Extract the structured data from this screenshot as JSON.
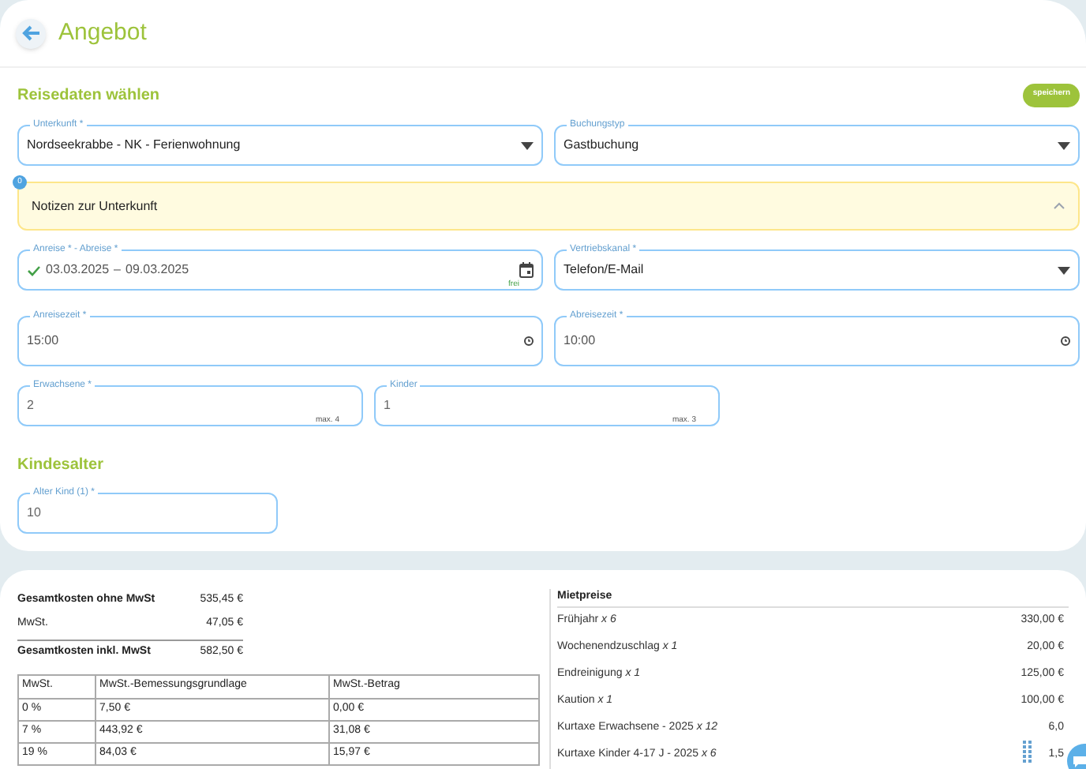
{
  "header": {
    "title": "Angebot"
  },
  "section_title": "Reisedaten wählen",
  "save_button": "speichern",
  "row1": [
    {
      "kind": "select",
      "label": "Unterkunft *",
      "value": "Nordseekrabbe - NK - Ferienwohnung"
    },
    {
      "kind": "select",
      "label": "Buchungstyp",
      "value": "Gastbuchung"
    }
  ],
  "notes": {
    "badge": "0",
    "title": "Notizen zur Unterkunft",
    "expanded": true
  },
  "row2": [
    {
      "kind": "daterange",
      "label": "Anreise * - Abreise *",
      "start": "03.03.2025",
      "sep": "–",
      "end": "09.03.2025",
      "hint": "frei",
      "valid": true
    },
    {
      "kind": "select",
      "label": "Vertriebskanal *",
      "value": "Telefon/E-Mail"
    }
  ],
  "row3": [
    {
      "kind": "time",
      "label": "Anreisezeit *",
      "value": "15:00"
    },
    {
      "kind": "time",
      "label": "Abreisezeit *",
      "value": "10:00"
    }
  ],
  "row4": [
    {
      "kind": "number",
      "label": "Erwachsene *",
      "value": "2",
      "hint": "max. 4"
    },
    {
      "kind": "number",
      "label": "Kinder",
      "value": "1",
      "hint": "max. 3"
    }
  ],
  "children_title": "Kindesalter",
  "child_ages": [
    {
      "kind": "number",
      "label": "Alter Kind (1) *",
      "value": "10"
    }
  ],
  "totals": [
    {
      "label": "Gesamtkosten ohne MwSt",
      "value": "535,45 €",
      "bold": true
    },
    {
      "label": "MwSt.",
      "value": "47,05 €",
      "bold": false
    },
    {
      "label": "Gesamtkosten inkl. MwSt",
      "value": "582,50 €",
      "bold": true
    }
  ],
  "vat_table": {
    "columns": [
      "MwSt.",
      "MwSt.-Bemessungsgrundlage",
      "MwSt.-Betrag"
    ],
    "rows": [
      [
        "0 %",
        "7,50 €",
        "0,00 €"
      ],
      [
        "7 %",
        "443,92 €",
        "31,08 €"
      ],
      [
        "19 %",
        "84,03 €",
        "15,97 €"
      ]
    ]
  },
  "prices": {
    "title": "Mietpreise",
    "items": [
      {
        "label": "Frühjahr *x 6*",
        "value": "330,00 €"
      },
      {
        "label": "Wochenendzuschlag *x 1*",
        "value": "20,00 €"
      },
      {
        "label": "Endreinigung *x 1*",
        "value": "125,00 €"
      },
      {
        "label": "Kaution *x 1*",
        "value": "100,00 €"
      },
      {
        "label": "Kurtaxe Erwachsene - 2025 *x 12*",
        "value": "6,0"
      },
      {
        "label": "Kurtaxe Kinder 4-17 J - 2025 *x 6*",
        "value": "1,5"
      }
    ]
  }
}
